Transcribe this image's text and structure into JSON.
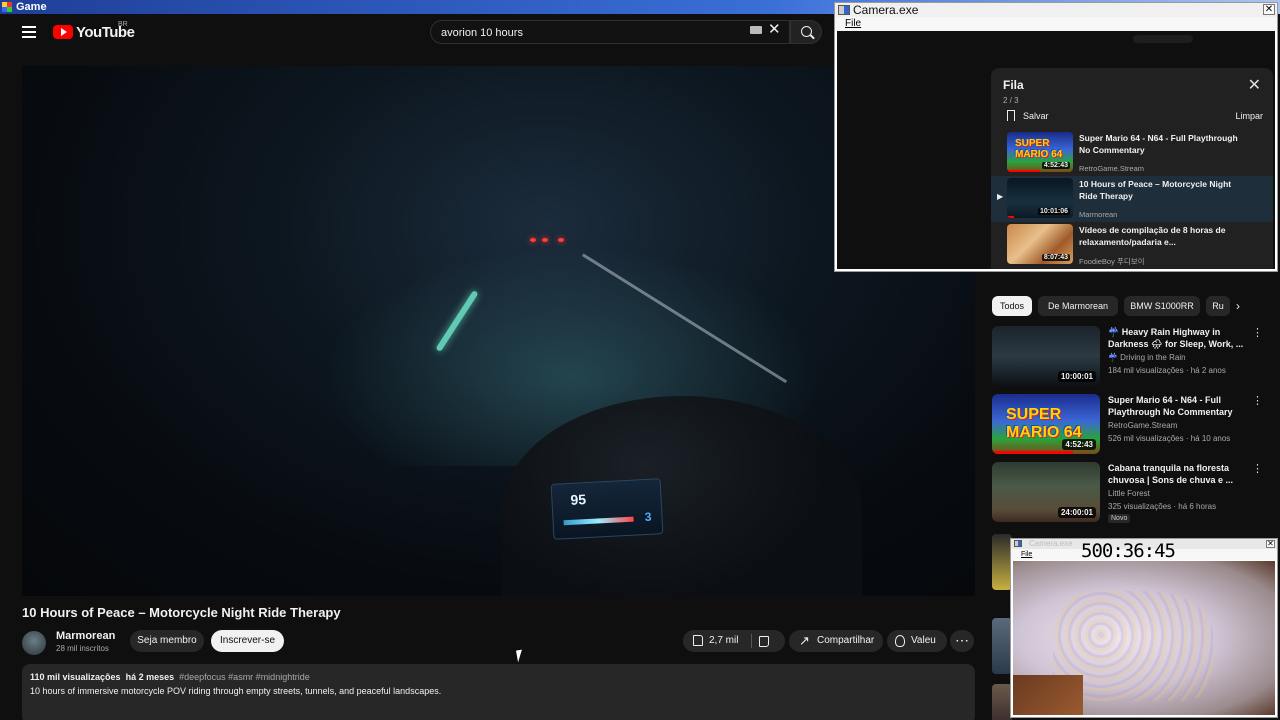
{
  "app": {
    "title": "Game"
  },
  "youtube": {
    "logo_text": "YouTube",
    "region": "BR",
    "search": {
      "value": "avorion 10 hours"
    }
  },
  "video": {
    "title": "10 Hours of Peace – Motorcycle Night Ride Therapy",
    "channel": {
      "name": "Marmorean",
      "subscribers": "28 mil inscritos"
    },
    "buttons": {
      "member": "Seja membro",
      "subscribe": "Inscrever-se"
    },
    "actions": {
      "likes": "2,7 mil",
      "share": "Compartilhar",
      "thanks": "Valeu",
      "more": "⋯"
    },
    "description": {
      "views": "110 mil visualizações",
      "age": "há 2 meses",
      "tags": "#deepfocus #asmr #midnightride",
      "text": "10 hours of immersive motorcycle POV riding through empty streets, tunnels, and peaceful landscapes."
    },
    "dashboard": {
      "speed": "95",
      "gear": "3"
    }
  },
  "chips": [
    {
      "label": "Todos",
      "active": true
    },
    {
      "label": "De Marmorean"
    },
    {
      "label": "BMW S1000RR"
    },
    {
      "label": "Ru"
    }
  ],
  "recommendations": [
    {
      "title": "☔ Heavy Rain Highway in Darkness 🌧 for Sleep, Work, ...",
      "channel": "☔ Driving in the Rain",
      "stats": "184 mil visualizações · há 2 anos",
      "duration": "10:00:01"
    },
    {
      "title": "Super Mario 64 - N64 - Full Playthrough No Commentary",
      "channel": "RetroGame.Stream",
      "stats": "526 mil visualizações · há 10 anos",
      "duration": "4:52:43",
      "thumb_text": "SUPER MARIO 64",
      "progress": 0.75
    },
    {
      "title": "Cabana tranquila na floresta chuvosa | Sons de chuva e ...",
      "channel": "Little Forest",
      "stats": "325 visualizações · há 6 horas",
      "duration": "24:00:01",
      "badge": "Novo"
    }
  ],
  "camera_main": {
    "title": "Camera.exe",
    "menu_file": "File",
    "queue": {
      "title": "Fila",
      "position": "2 / 3",
      "save": "Salvar",
      "clear": "Limpar",
      "current_marker": "▶",
      "items": [
        {
          "title": "Super Mario 64 - N64 - Full Playthrough No Commentary",
          "channel": "RetroGame.Stream",
          "duration": "4:52:43",
          "thumb_text": "SUPER MARIO 64",
          "progress": 0.5
        },
        {
          "title": "10 Hours of Peace – Motorcycle Night Ride Therapy",
          "channel": "Marmorean",
          "duration": "10:01:06",
          "current": true,
          "progress": 0.1
        },
        {
          "title": "Vídeos de compilação de 8 horas de relaxamento/padaria e...",
          "channel": "FoodieBoy 푸디보이",
          "duration": "8:07:43"
        }
      ]
    }
  },
  "camera_small": {
    "title": "Camera.exe",
    "menu_file": "File",
    "timer": "500:36:45"
  },
  "colors": {
    "brand_red": "#ff0000",
    "background": "#0f0f0f",
    "chip_bg": "#272727",
    "queue_bg": "#212121"
  }
}
